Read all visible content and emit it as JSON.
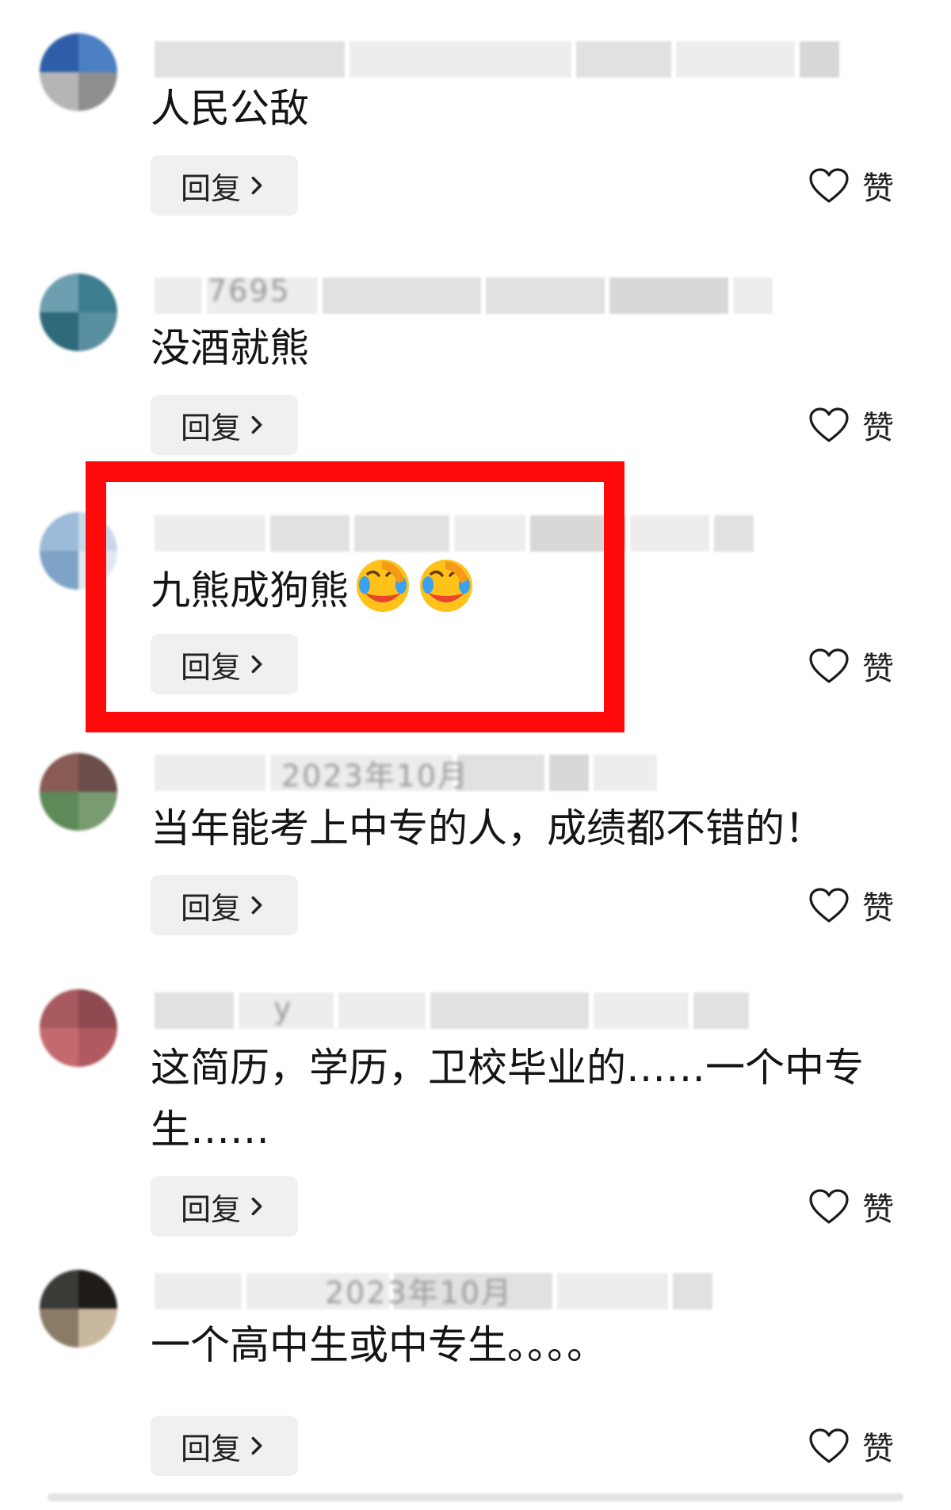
{
  "comments": [
    {
      "meta": "",
      "text": "人民公敌",
      "reply_label": "回复",
      "like_label": "赞",
      "avatar_colors": [
        "#2f5ea8",
        "#4a7fc4",
        "#b5b5b5",
        "#8e8e8e"
      ]
    },
    {
      "meta": "7695",
      "text": "没酒就熊",
      "reply_label": "回复",
      "like_label": "赞",
      "avatar_colors": [
        "#6d9fb0",
        "#3e7c90",
        "#2e6a7a",
        "#5a8f9f"
      ]
    },
    {
      "meta": "",
      "text": "九熊成狗熊",
      "emojis": [
        "face-palm-laughing-icon",
        "face-palm-laughing-icon"
      ],
      "reply_label": "回复",
      "like_label": "赞",
      "avatar_colors": [
        "#9bbbd8",
        "#c8d8e8",
        "#7fa3c6",
        "#dfe8f0"
      ]
    },
    {
      "meta": "2023年10月",
      "text": "当年能考上中专的人，成绩都不错的！",
      "reply_label": "回复",
      "like_label": "赞",
      "avatar_colors": [
        "#8a5a55",
        "#6b4d4a",
        "#5e8a5a",
        "#7a9a72"
      ]
    },
    {
      "meta": "y",
      "text": "这简历，学历，卫校毕业的……一个中专生……",
      "reply_label": "回复",
      "like_label": "赞",
      "avatar_colors": [
        "#a85a5e",
        "#8e4a50",
        "#c46a6e",
        "#b05a60"
      ]
    },
    {
      "meta": "2023年10月",
      "text": "一个高中生或中专生。。。。",
      "reply_label": "回复",
      "like_label": "赞",
      "avatar_colors": [
        "#3a3a36",
        "#1f1c18",
        "#8a7a66",
        "#c9b8a0"
      ]
    }
  ],
  "colors": {
    "highlight": "#ff0a0a",
    "reply_bg": "#f0f0f0",
    "text": "#141414"
  }
}
